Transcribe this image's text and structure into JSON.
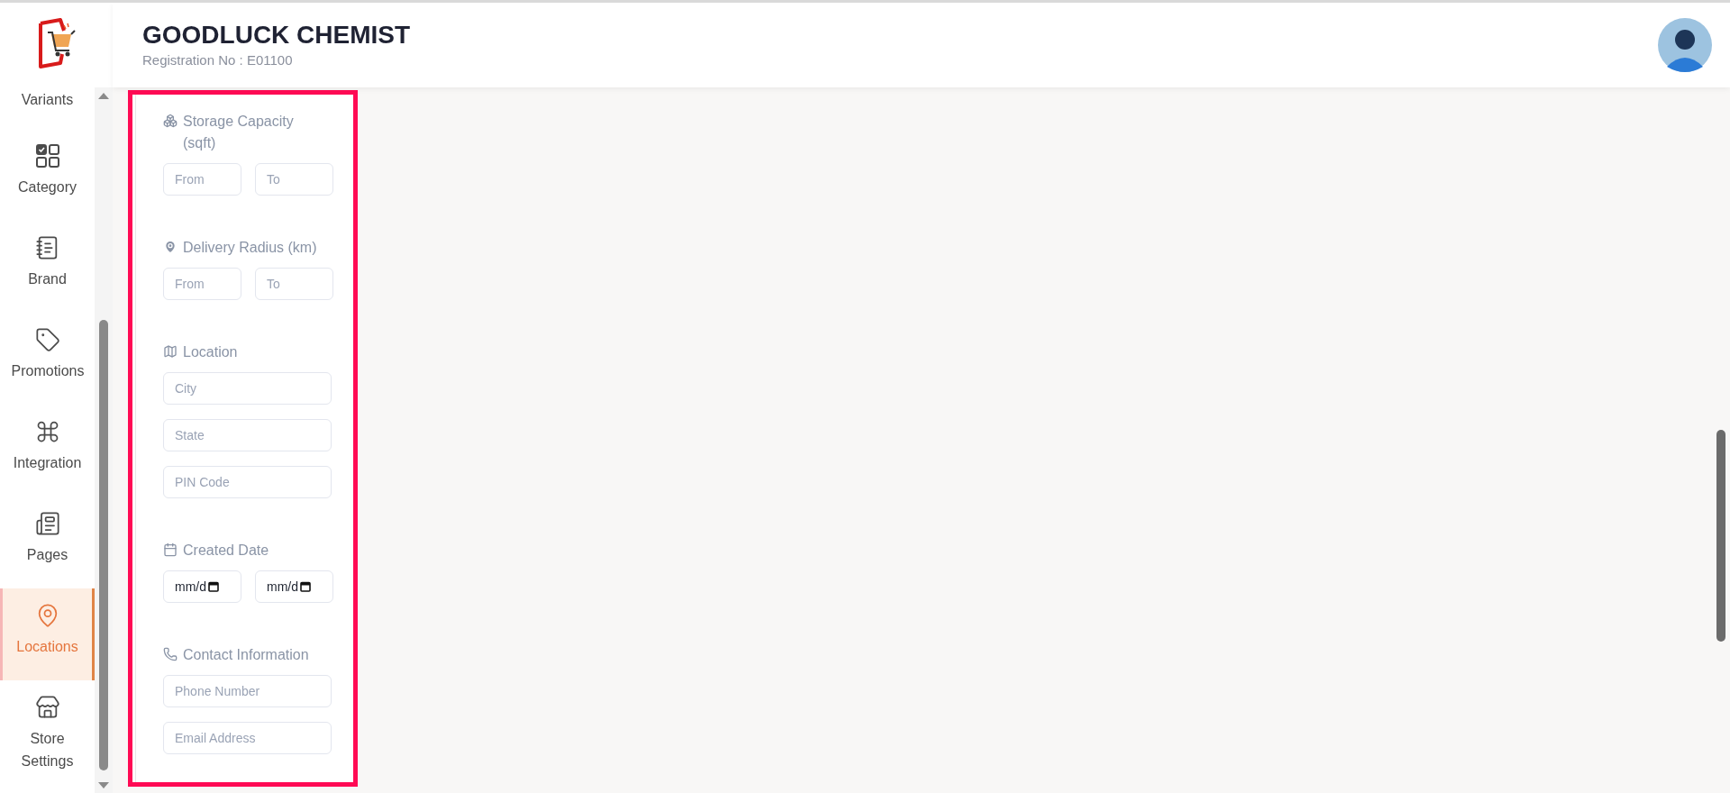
{
  "header": {
    "title": "GOODLUCK CHEMIST",
    "subtitle": "Registration No : E01100"
  },
  "sidebar": {
    "partial_item": "Variants",
    "items": [
      {
        "label": "Category",
        "selected": false
      },
      {
        "label": "Brand",
        "selected": false
      },
      {
        "label": "Promotions",
        "selected": false
      },
      {
        "label": "Integration",
        "selected": false
      },
      {
        "label": "Pages",
        "selected": false
      },
      {
        "label": "Locations",
        "selected": true
      },
      {
        "label": "Store Settings",
        "selected": false
      }
    ]
  },
  "filters": [
    {
      "label": "Storage Capacity (sqft)",
      "fields": [
        {
          "kind": "text",
          "placeholder": "From"
        },
        {
          "kind": "text",
          "placeholder": "To"
        }
      ]
    },
    {
      "label": "Delivery Radius (km)",
      "fields": [
        {
          "kind": "text",
          "placeholder": "From"
        },
        {
          "kind": "text",
          "placeholder": "To"
        }
      ]
    },
    {
      "label": "Location",
      "fields": [
        {
          "kind": "text",
          "placeholder": "City"
        },
        {
          "kind": "text",
          "placeholder": "State"
        },
        {
          "kind": "text",
          "placeholder": "PIN Code"
        }
      ]
    },
    {
      "label": "Created Date",
      "fields": [
        {
          "kind": "date",
          "value": "mm/d"
        },
        {
          "kind": "date",
          "value": "mm/d"
        }
      ]
    },
    {
      "label": "Contact Information",
      "fields": [
        {
          "kind": "text",
          "placeholder": "Phone Number"
        },
        {
          "kind": "text",
          "placeholder": "Email Address"
        }
      ]
    }
  ]
}
